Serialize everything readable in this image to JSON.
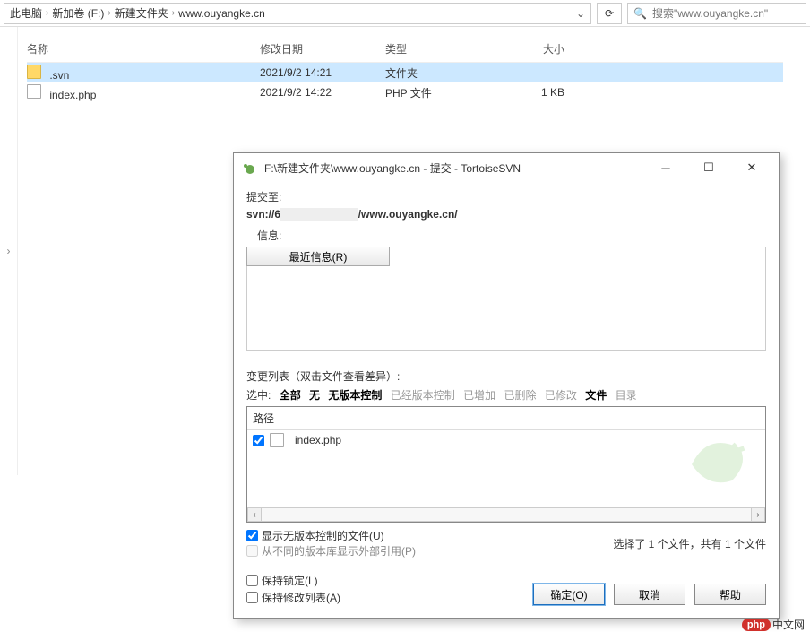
{
  "breadcrumb": {
    "items": [
      "此电脑",
      "新加卷 (F:)",
      "新建文件夹",
      "www.ouyangke.cn"
    ]
  },
  "search": {
    "placeholder": "搜索\"www.ouyangke.cn\""
  },
  "explorer": {
    "columns": {
      "name": "名称",
      "date": "修改日期",
      "type": "类型",
      "size": "大小"
    },
    "rows": [
      {
        "name": ".svn",
        "date": "2021/9/2 14:21",
        "type": "文件夹",
        "size": "",
        "kind": "folder",
        "selected": true
      },
      {
        "name": "index.php",
        "date": "2021/9/2 14:22",
        "type": "PHP 文件",
        "size": "1 KB",
        "kind": "file",
        "selected": false
      }
    ]
  },
  "dialog": {
    "title": "F:\\新建文件夹\\www.ouyangke.cn - 提交 - TortoiseSVN",
    "commit_to_label": "提交至:",
    "commit_url_prefix": "svn://6",
    "commit_url_suffix": "/www.ouyangke.cn/",
    "info_label": "信息:",
    "recent_btn": "最近信息(R)",
    "changelist_label": "变更列表（双击文件查看差异）:",
    "filter_prefix": "选中:",
    "filters": {
      "all": "全部",
      "none": "无",
      "unversioned": "无版本控制",
      "versioned": "已经版本控制",
      "added": "已增加",
      "deleted": "已删除",
      "modified": "已修改",
      "files": "文件",
      "dirs": "目录"
    },
    "changelist_header": "路径",
    "changelist_items": [
      {
        "checked": true,
        "name": "index.php"
      }
    ],
    "show_unversioned": "显示无版本控制的文件(U)",
    "show_externals": "从不同的版本库显示外部引用(P)",
    "selection_text": "选择了 1 个文件，共有 1 个文件",
    "keep_locks": "保持锁定(L)",
    "keep_changelists": "保持修改列表(A)",
    "ok": "确定(O)",
    "cancel": "取消",
    "help": "帮助"
  },
  "overlay": {
    "logo": "php",
    "text": "中文网"
  }
}
